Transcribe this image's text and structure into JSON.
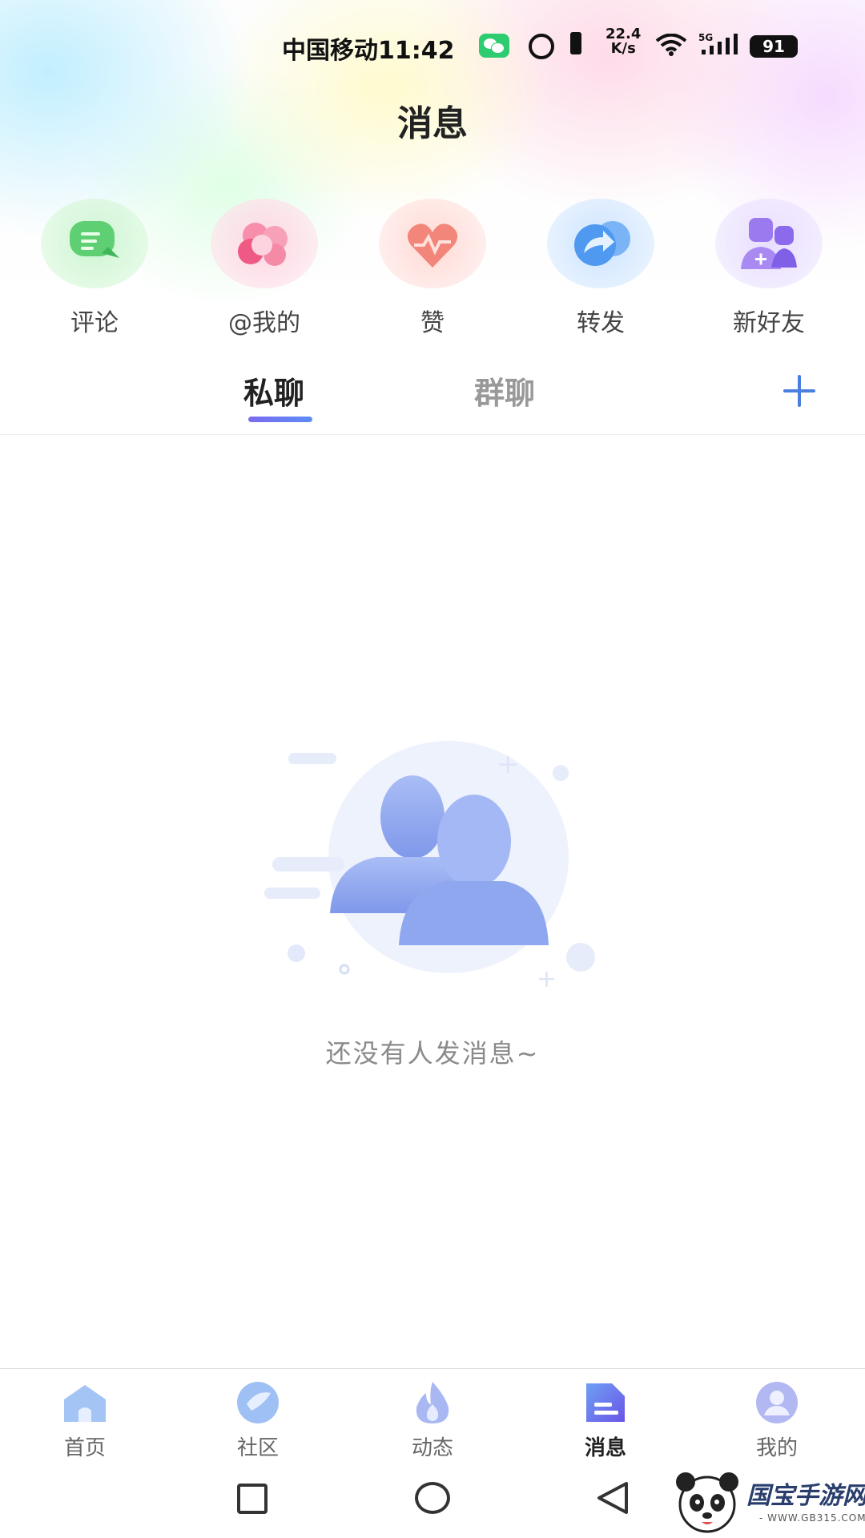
{
  "status_bar": {
    "carrier_time": "中国移动11:42",
    "net_speed_value": "22.4",
    "net_speed_unit": "K/s",
    "battery": "91",
    "icons": [
      "wechat-icon",
      "alarm-icon",
      "vibrate-icon",
      "wifi-icon",
      "signal-5g-icon",
      "battery-icon"
    ]
  },
  "header": {
    "title": "消息"
  },
  "shortcuts": [
    {
      "label": "评论",
      "icon": "comment-bubble-icon",
      "color": "#5fcf74"
    },
    {
      "label": "@我的",
      "icon": "mention-icon",
      "color": "#f0608a"
    },
    {
      "label": "赞",
      "icon": "heart-like-icon",
      "color": "#f08a80"
    },
    {
      "label": "转发",
      "icon": "share-forward-icon",
      "color": "#4f9af0"
    },
    {
      "label": "新好友",
      "icon": "new-friend-icon",
      "color": "#9b7af0"
    }
  ],
  "tabs": {
    "items": [
      {
        "label": "私聊",
        "active": true
      },
      {
        "label": "群聊",
        "active": false
      }
    ],
    "accent": "#6a7cf0"
  },
  "empty_state": {
    "text": "还没有人发消息~"
  },
  "bottom_nav": [
    {
      "label": "首页",
      "icon": "home-icon",
      "active": false
    },
    {
      "label": "社区",
      "icon": "community-icon",
      "active": false
    },
    {
      "label": "动态",
      "icon": "flame-icon",
      "active": false
    },
    {
      "label": "消息",
      "icon": "message-icon",
      "active": true
    },
    {
      "label": "我的",
      "icon": "profile-icon",
      "active": false
    }
  ],
  "system_nav": [
    "recent-apps-icon",
    "home-circle-icon",
    "back-triangle-icon"
  ],
  "watermark": {
    "text": "国宝手游网",
    "sub": "- WWW.GB315.COM -"
  }
}
